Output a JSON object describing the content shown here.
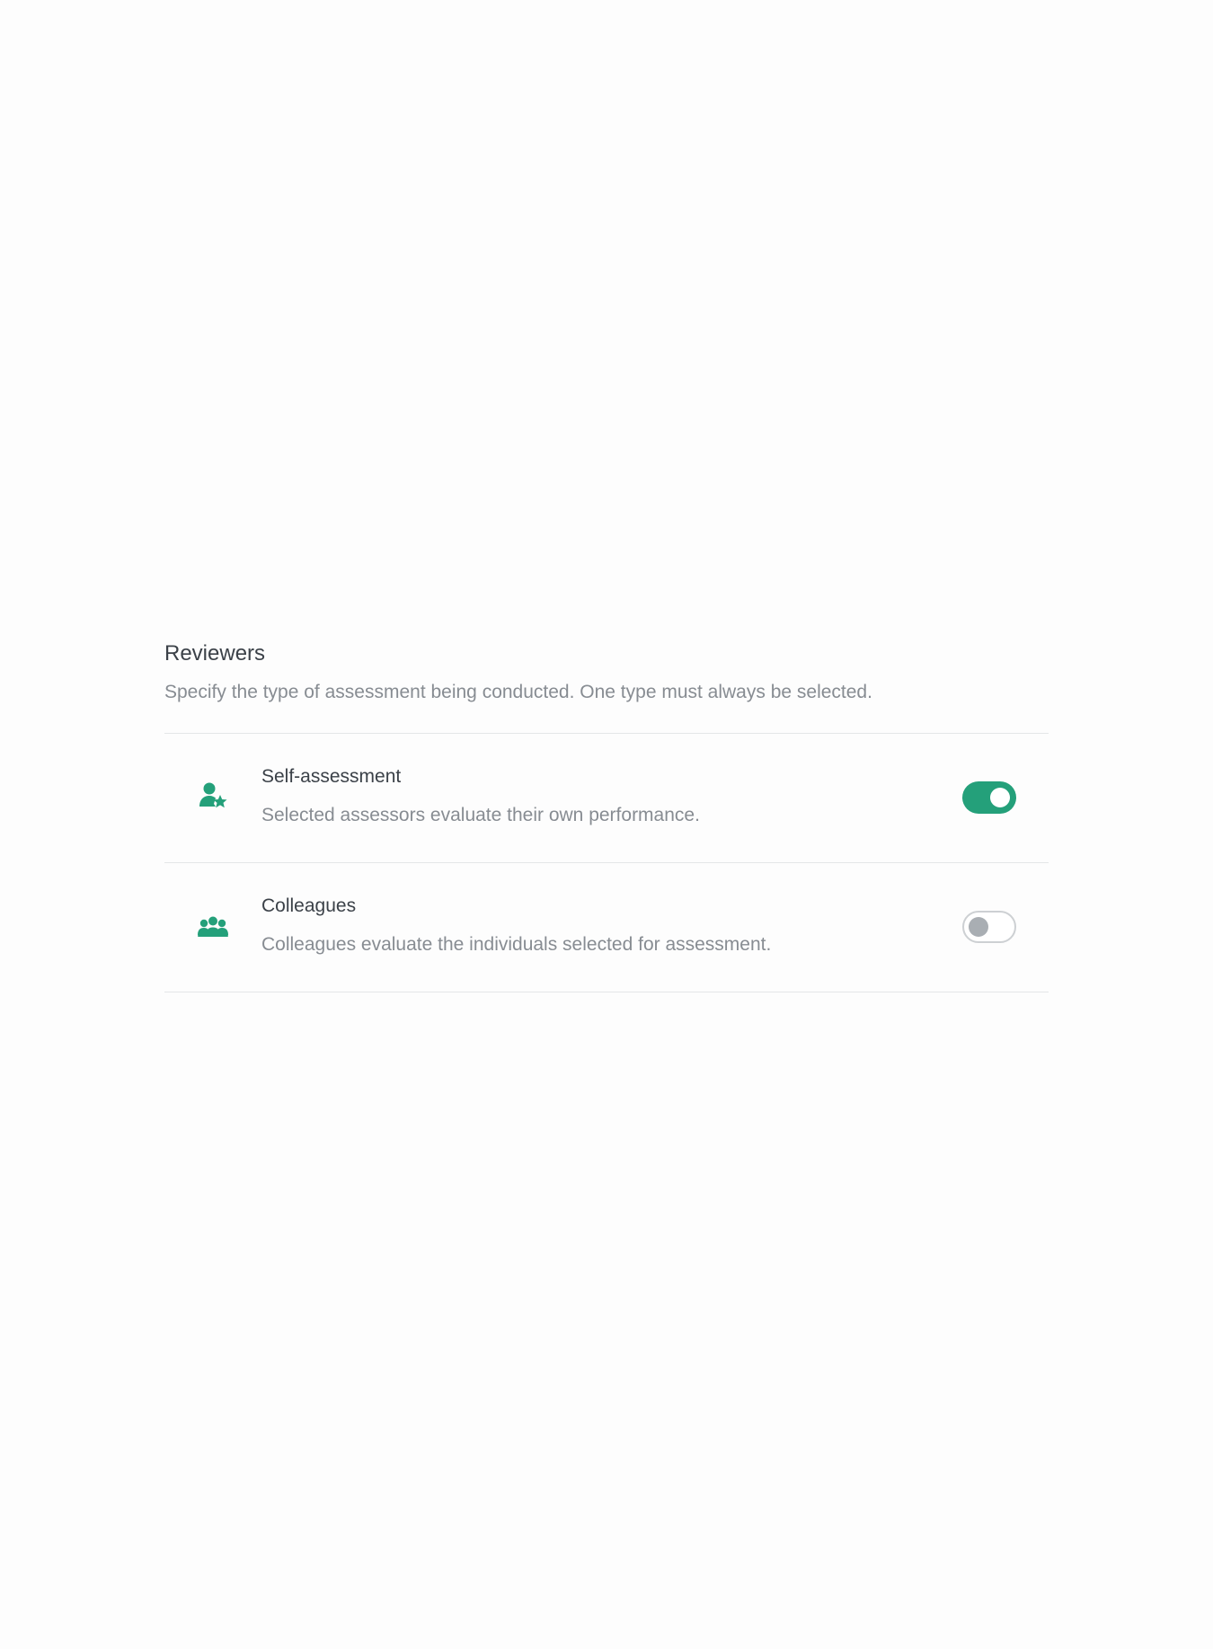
{
  "reviewers": {
    "title": "Reviewers",
    "description": "Specify the type of assessment being conducted. One type must always be selected.",
    "accent_color": "#24a07a",
    "options": [
      {
        "icon": "user-star-icon",
        "title": "Self-assessment",
        "description": "Selected assessors evaluate their own performance.",
        "enabled": true
      },
      {
        "icon": "group-icon",
        "title": "Colleagues",
        "description": "Colleagues evaluate the individuals selected for assessment.",
        "enabled": false
      }
    ]
  }
}
